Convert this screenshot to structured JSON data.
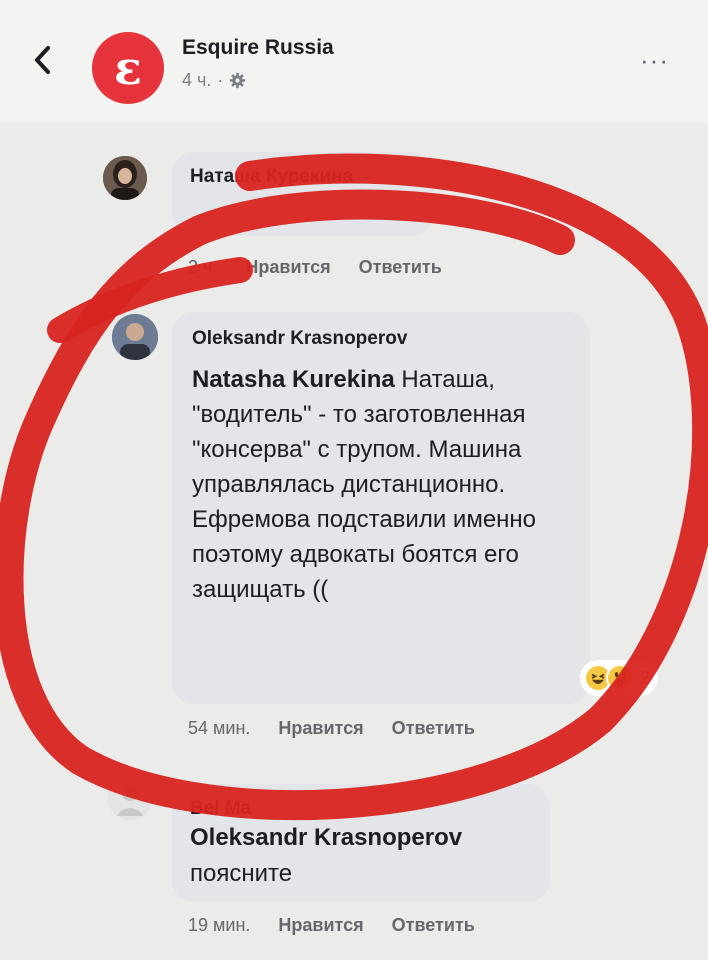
{
  "header": {
    "page_name": "Esquire Russia",
    "time": "4 ч.",
    "dot": "·",
    "logo_letter": "ε",
    "more": "···"
  },
  "comments": [
    {
      "author": "Наташа Курекина",
      "time": "2 ч.",
      "like": "Нравится",
      "reply": "Ответить"
    },
    {
      "author": "Oleksandr Krasnoperov",
      "mention": "Natasha Kurekina",
      "text": " Наташа, \"водитель\" - то заготовленная \"консерва\" с трупом. Машина управлялась дистанционно. Ефремова подставили именно поэтому адвокаты боятся его защищать ((",
      "reaction_count": "2",
      "time": "54 мин.",
      "like": "Нравится",
      "reply": "Ответить"
    },
    {
      "author": "Bel Ma",
      "mention": "Oleksandr Krasnoperov",
      "text": "поясните",
      "time": "19 мин.",
      "like": "Нравится",
      "reply": "Ответить"
    }
  ],
  "colors": {
    "marker_red": "#d8241f",
    "logo_red": "#e5323b",
    "bubble": "#e4e5e8"
  },
  "icons": [
    "back-chevron-icon",
    "gear-icon",
    "more-icon",
    "haha-reaction-icon",
    "wow-reaction-icon"
  ]
}
